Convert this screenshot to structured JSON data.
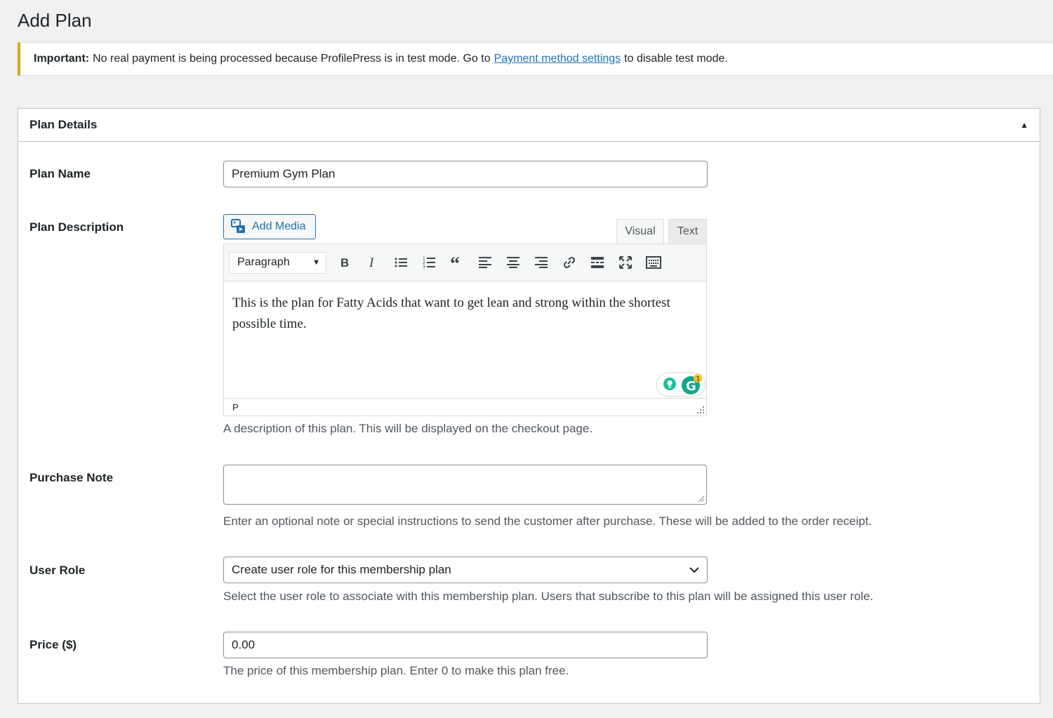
{
  "page": {
    "title": "Add Plan"
  },
  "notice": {
    "strong": "Important:",
    "text_before": "No real payment is being processed because ProfilePress is in test mode. Go to",
    "link": "Payment method settings",
    "text_after": "to disable test mode.",
    "accent_color": "#dba617"
  },
  "panel": {
    "title": "Plan Details",
    "toggle_icon": "triangle-up"
  },
  "plan_name": {
    "label": "Plan Name",
    "value": "Premium Gym Plan"
  },
  "plan_description": {
    "label": "Plan Description",
    "add_media_label": "Add Media",
    "tabs": {
      "visual": "Visual",
      "text": "Text"
    },
    "format_select": "Paragraph",
    "toolbar_icons": [
      "bold-icon",
      "italic-icon",
      "bullet-list-icon",
      "numbered-list-icon",
      "blockquote-icon",
      "align-left-icon",
      "align-center-icon",
      "align-right-icon",
      "link-icon",
      "read-more-icon",
      "fullscreen-icon",
      "toolbar-toggle-icon"
    ],
    "content": "This is the plan for Fatty Acids that want to get lean and strong within the shortest possible time.",
    "status_path": "P",
    "grammarly_badge": "1",
    "hint": "A description of this plan. This will be displayed on the checkout page."
  },
  "purchase_note": {
    "label": "Purchase Note",
    "value": "",
    "hint": "Enter an optional note or special instructions to send the customer after purchase. These will be added to the order receipt."
  },
  "user_role": {
    "label": "User Role",
    "selected": "Create user role for this membership plan",
    "hint": "Select the user role to associate with this membership plan. Users that subscribe to this plan will be assigned this user role."
  },
  "price": {
    "label": "Price ($)",
    "value": "0.00",
    "hint": "The price of this membership plan. Enter 0 to make this plan free."
  },
  "colors": {
    "link": "#2271b1",
    "grammarly": "#15c39a",
    "grammarly_dark": "#11a683"
  }
}
